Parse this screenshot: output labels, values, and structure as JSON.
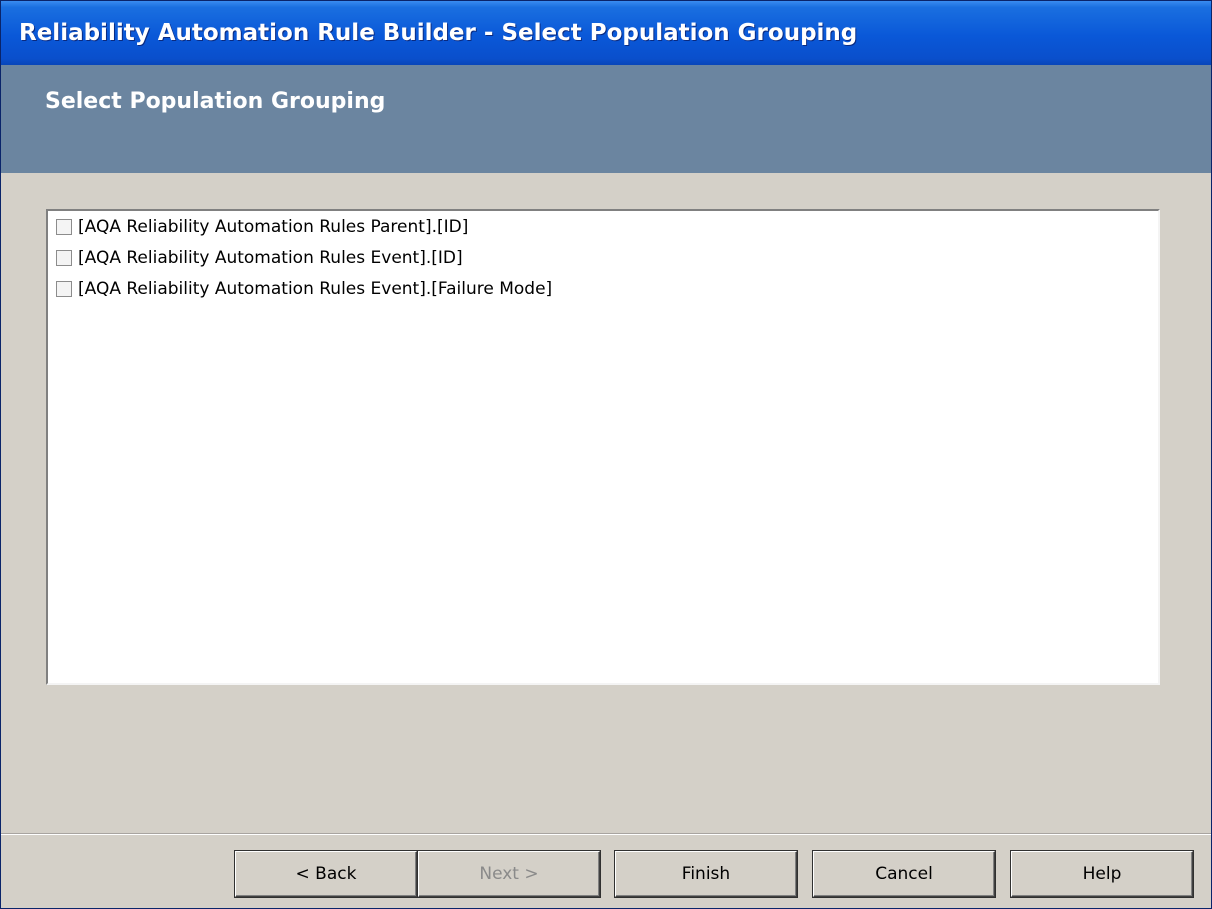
{
  "window": {
    "title": "Reliability Automation Rule Builder - Select Population Grouping"
  },
  "header": {
    "title": "Select Population Grouping"
  },
  "list": {
    "items": [
      {
        "label": "[AQA Reliability Automation Rules Parent].[ID]",
        "checked": false
      },
      {
        "label": "[AQA Reliability Automation Rules Event].[ID]",
        "checked": false
      },
      {
        "label": "[AQA Reliability Automation Rules Event].[Failure Mode]",
        "checked": false
      }
    ]
  },
  "buttons": {
    "back": {
      "label": "< Back",
      "enabled": true
    },
    "next": {
      "label": "Next >",
      "enabled": false
    },
    "finish": {
      "label": "Finish",
      "enabled": true
    },
    "cancel": {
      "label": "Cancel",
      "enabled": true
    },
    "help": {
      "label": "Help",
      "enabled": true
    }
  },
  "colors": {
    "titlebar": "#0a58d8",
    "header_band": "#6b85a0",
    "window_bg": "#d4d0c8",
    "disabled_text": "#8a8a8a"
  }
}
